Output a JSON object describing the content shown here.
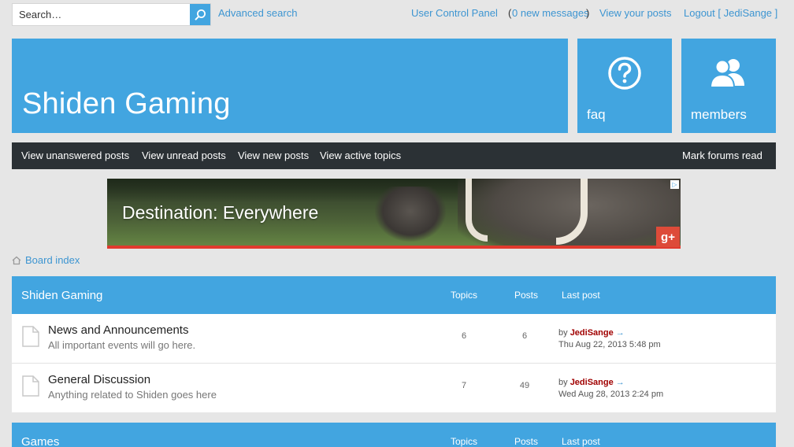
{
  "search": {
    "placeholder": "Search…"
  },
  "top_links": {
    "advanced_search": "Advanced search",
    "user_control_panel": "User Control Panel",
    "messages_open": "(",
    "new_messages": "0 new messages",
    "messages_close": ")",
    "view_your_posts": "View your posts",
    "logout": "Logout [ JediSange ]"
  },
  "header": {
    "site_title": "Shiden Gaming",
    "faq_label": "faq",
    "members_label": "members"
  },
  "nav": {
    "unanswered": "View unanswered posts",
    "unread": "View unread posts",
    "new_posts": "View new posts",
    "active_topics": "View active topics",
    "mark_read": "Mark forums read"
  },
  "ad": {
    "text": "Destination: Everywhere",
    "gplus": "g+",
    "choice": "▷"
  },
  "breadcrumb": {
    "label": "Board index"
  },
  "categories": [
    {
      "title": "Shiden Gaming",
      "col_topics": "Topics",
      "col_posts": "Posts",
      "col_last": "Last post",
      "forums": [
        {
          "title": "News and Announcements",
          "description": "All important events will go here.",
          "topics": "6",
          "posts": "6",
          "by": "by",
          "user": "JediSange",
          "arrow": "→",
          "date": "Thu Aug 22, 2013 5:48 pm"
        },
        {
          "title": "General Discussion",
          "description": "Anything related to Shiden goes here",
          "topics": "7",
          "posts": "49",
          "by": "by",
          "user": "JediSange",
          "arrow": "→",
          "date": "Wed Aug 28, 2013 2:24 pm"
        }
      ]
    },
    {
      "title": "Games",
      "col_topics": "Topics",
      "col_posts": "Posts",
      "col_last": "Last post"
    }
  ],
  "colors": {
    "accent": "#42a5e0",
    "nav_bg": "#2b3135",
    "link": "#3d95d1",
    "username": "#a00000",
    "page_bg": "#e6e6e6"
  },
  "icons": {
    "search": "search-icon",
    "faq": "question-circle-icon",
    "members": "users-icon",
    "home": "home-icon",
    "forum": "document-icon"
  }
}
